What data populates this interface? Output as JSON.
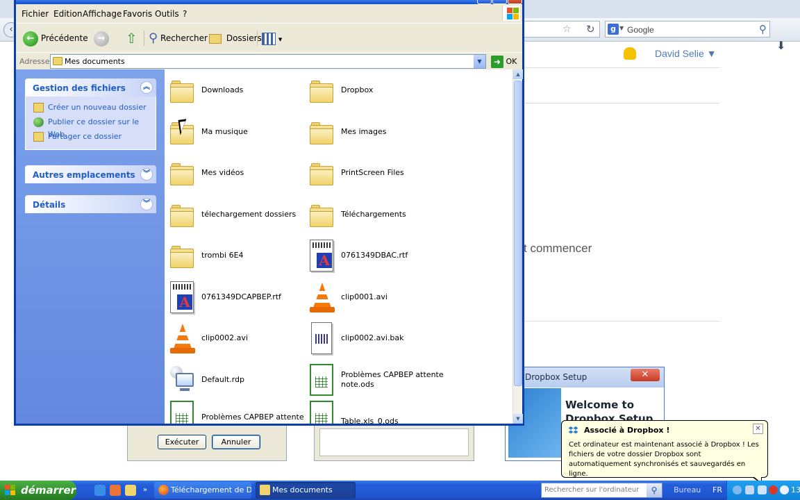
{
  "explorer": {
    "menu": [
      "Fichier",
      "Edition",
      "Affichage",
      "Favoris",
      "Outils",
      "?"
    ],
    "toolbar": {
      "back_label": "Précédente",
      "search_label": "Rechercher",
      "folders_label": "Dossiers"
    },
    "address": {
      "label": "Adresse",
      "value": "Mes documents",
      "go_label": "OK"
    },
    "panels": {
      "file_tasks": {
        "title": "Gestion des fichiers",
        "items": [
          "Créer un nouveau dossier",
          "Publier ce dossier sur le Web",
          "Partager ce dossier"
        ]
      },
      "other_places": {
        "title": "Autres emplacements"
      },
      "details": {
        "title": "Détails"
      }
    },
    "files": [
      {
        "name": "Downloads",
        "icon": "folder-icon"
      },
      {
        "name": "Dropbox",
        "icon": "folder-icon"
      },
      {
        "name": "Ma musique",
        "icon": "folder-icon"
      },
      {
        "name": "Mes images",
        "icon": "folder-icon"
      },
      {
        "name": "Mes vidéos",
        "icon": "folder-icon"
      },
      {
        "name": "PrintScreen Files",
        "icon": "folder-icon"
      },
      {
        "name": "télechargement dossiers",
        "icon": "folder-icon"
      },
      {
        "name": "Téléchargements",
        "icon": "folder-icon"
      },
      {
        "name": "trombi 6E4",
        "icon": "folder-icon"
      },
      {
        "name": "0761349DBAC.rtf",
        "icon": "rtf-document-icon"
      },
      {
        "name": "0761349DCAPBEP.rtf",
        "icon": "rtf-document-icon"
      },
      {
        "name": "clip0001.avi",
        "icon": "vlc-cone-icon"
      },
      {
        "name": "clip0002.avi",
        "icon": "vlc-cone-icon"
      },
      {
        "name": "clip0002.avi.bak",
        "icon": "bak-file-icon"
      },
      {
        "name": "Default.rdp",
        "icon": "remote-desktop-icon"
      },
      {
        "name": "Problèmes CAPBEP attente note.ods",
        "icon": "spreadsheet-icon"
      },
      {
        "name": "Problèmes CAPBEP attente",
        "icon": "spreadsheet-icon"
      },
      {
        "name": "Table.xls_0.ods",
        "icon": "spreadsheet-icon"
      }
    ]
  },
  "browser": {
    "search_placeholder": "Google",
    "user_name": "David Selie ▼",
    "content_text": "t commencer"
  },
  "run_dialog": {
    "execute_label": "Exécuter",
    "cancel_label": "Annuler"
  },
  "dropbox_setup": {
    "title": "Dropbox Setup",
    "welcome": "Welcome to Dropbox Setup"
  },
  "balloon": {
    "title": "Associé à Dropbox !",
    "text": "Cet ordinateur est maintenant associé à Dropbox ! Les fichiers de votre dossier Dropbox sont automatiquement synchronisés et sauvegardés en ligne."
  },
  "taskbar": {
    "start_label": "démarrer",
    "tasks": [
      "Téléchargement de D...",
      "Mes documents"
    ],
    "search_placeholder": "Rechercher sur l'ordinateur",
    "bureau_label": "Bureau",
    "language": "FR",
    "clock": "13"
  },
  "colors": {
    "xp_blue": "#0a3ea8",
    "panel_blue": "#6388e0",
    "link_blue": "#215dc6",
    "start_green": "#2f8f2a"
  }
}
